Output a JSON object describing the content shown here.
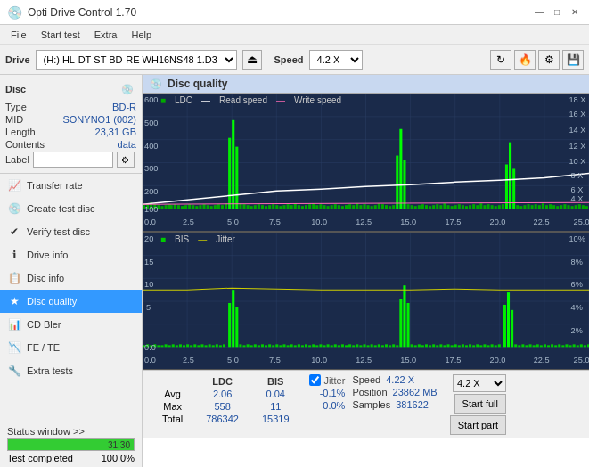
{
  "titlebar": {
    "title": "Opti Drive Control 1.70",
    "icon": "💿",
    "minimize": "—",
    "maximize": "□",
    "close": "✕"
  },
  "menubar": {
    "items": [
      "File",
      "Start test",
      "Extra",
      "Help"
    ]
  },
  "drivebar": {
    "label": "Drive",
    "drive_value": "(H:)  HL-DT-ST BD-RE  WH16NS48 1.D3",
    "speed_label": "Speed",
    "speed_value": "4.2 X"
  },
  "disc": {
    "title": "Disc",
    "type_label": "Type",
    "type_val": "BD-R",
    "mid_label": "MID",
    "mid_val": "SONYNO1 (002)",
    "length_label": "Length",
    "length_val": "23,31 GB",
    "contents_label": "Contents",
    "contents_val": "data",
    "label_label": "Label"
  },
  "nav": {
    "items": [
      {
        "id": "transfer-rate",
        "icon": "📈",
        "label": "Transfer rate"
      },
      {
        "id": "create-test-disc",
        "icon": "💿",
        "label": "Create test disc"
      },
      {
        "id": "verify-test-disc",
        "icon": "✔",
        "label": "Verify test disc"
      },
      {
        "id": "drive-info",
        "icon": "ℹ",
        "label": "Drive info"
      },
      {
        "id": "disc-info",
        "icon": "📋",
        "label": "Disc info"
      },
      {
        "id": "disc-quality",
        "icon": "★",
        "label": "Disc quality",
        "active": true
      },
      {
        "id": "cd-bler",
        "icon": "📊",
        "label": "CD Bler"
      },
      {
        "id": "fe-te",
        "icon": "📉",
        "label": "FE / TE"
      },
      {
        "id": "extra-tests",
        "icon": "🔧",
        "label": "Extra tests"
      }
    ]
  },
  "statusbar": {
    "link_text": "Status window >>",
    "status_text": "Test completed",
    "progress": 100,
    "time": "31:30"
  },
  "disc_quality": {
    "title": "Disc quality",
    "legend": {
      "ldc": "LDC",
      "read_speed": "Read speed",
      "write_speed": "Write speed",
      "bis": "BIS",
      "jitter": "Jitter"
    }
  },
  "stats": {
    "headers": [
      "LDC",
      "BIS"
    ],
    "avg_label": "Avg",
    "max_label": "Max",
    "total_label": "Total",
    "avg_ldc": "2.06",
    "avg_bis": "0.04",
    "max_ldc": "558",
    "max_bis": "11",
    "total_ldc": "786342",
    "total_bis": "15319",
    "jitter_label": "Jitter",
    "jitter_avg": "-0.1%",
    "jitter_max": "0.0%",
    "speed_label": "Speed",
    "speed_val": "4.22 X",
    "position_label": "Position",
    "position_val": "23862 MB",
    "samples_label": "Samples",
    "samples_val": "381622",
    "speed_select": "4.2 X",
    "start_full": "Start full",
    "start_part": "Start part"
  },
  "colors": {
    "ldc": "#00aa00",
    "read_speed": "#ffffff",
    "write_speed": "#ff69b4",
    "bis": "#00dd00",
    "jitter": "#ffff00",
    "chart_bg": "#1a2a4a",
    "chart_grid": "#2a3e64",
    "accent_blue": "#2050a0"
  }
}
